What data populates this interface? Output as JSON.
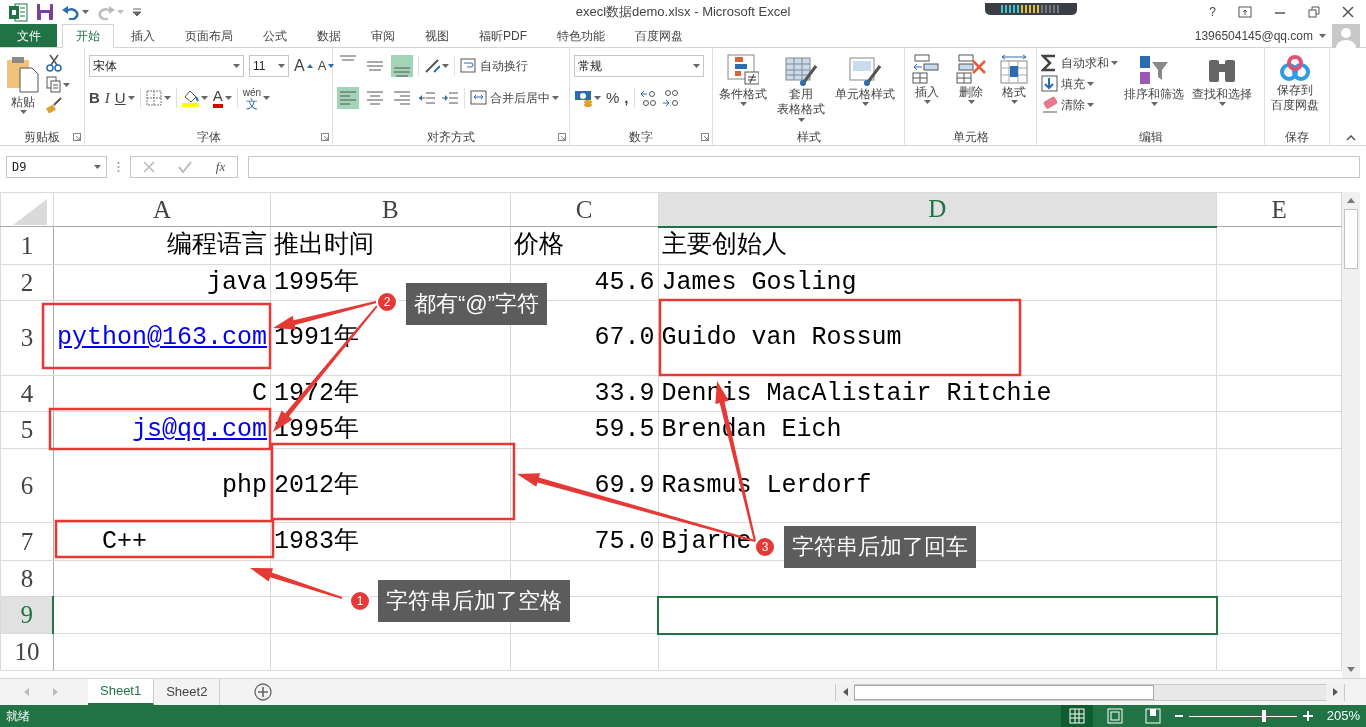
{
  "window": {
    "title": "execl数据demo.xlsx - Microsoft Excel",
    "help": "?"
  },
  "menu_tabs": [
    {
      "label": "文件",
      "kind": "file",
      "selected": false
    },
    {
      "label": "开始",
      "kind": "tab",
      "selected": true
    },
    {
      "label": "插入",
      "kind": "tab",
      "selected": false
    },
    {
      "label": "页面布局",
      "kind": "tab",
      "selected": false
    },
    {
      "label": "公式",
      "kind": "tab",
      "selected": false
    },
    {
      "label": "数据",
      "kind": "tab",
      "selected": false
    },
    {
      "label": "审阅",
      "kind": "tab",
      "selected": false
    },
    {
      "label": "视图",
      "kind": "tab",
      "selected": false
    },
    {
      "label": "福昕PDF",
      "kind": "tab",
      "selected": false
    },
    {
      "label": "特色功能",
      "kind": "tab",
      "selected": false
    },
    {
      "label": "百度网盘",
      "kind": "tab",
      "selected": false
    }
  ],
  "account": {
    "email": "1396504145@qq.com"
  },
  "ribbon": {
    "groups": [
      {
        "title": "剪贴板",
        "buttons": [
          {
            "label": "粘贴"
          }
        ]
      },
      {
        "title": "字体",
        "font": "宋体",
        "size": "11",
        "buttons": [
          {
            "label": "A"
          },
          {
            "label": "A"
          },
          {
            "label": "B"
          },
          {
            "label": "I"
          },
          {
            "label": "U"
          },
          {
            "label": "A"
          },
          {
            "lines": [
              "wén",
              "文"
            ]
          }
        ]
      },
      {
        "title": "对齐方式",
        "aligns": [
          {
            "selected": false
          },
          {
            "selected": false
          },
          {
            "selected": true
          },
          {
            "selected": true
          },
          {
            "selected": false
          },
          {
            "selected": false
          }
        ],
        "buttons": [
          {
            "label": "自动换行"
          },
          {
            "label": "合并后居中"
          }
        ]
      },
      {
        "title": "数字",
        "format": "常规",
        "buttons": [
          {
            "label": "%"
          },
          {
            "label": ","
          }
        ]
      },
      {
        "title": "样式",
        "buttons": [
          {
            "label": "条件格式"
          },
          {
            "lines": [
              "套用",
              "表格格式"
            ]
          },
          {
            "label": "单元格样式"
          }
        ]
      },
      {
        "title": "单元格",
        "buttons": [
          {
            "label": "插入"
          },
          {
            "label": "删除"
          },
          {
            "label": "格式"
          }
        ]
      },
      {
        "title": "编辑",
        "buttons": [
          {
            "label": "自动求和"
          },
          {
            "label": "填充"
          },
          {
            "label": "清除"
          },
          {
            "label": "排序和筛选"
          },
          {
            "label": "查找和选择"
          }
        ]
      },
      {
        "title": "保存",
        "buttons": [
          {
            "lines": [
              "保存到",
              "百度网盘"
            ]
          }
        ]
      }
    ]
  },
  "formula_bar": {
    "name_box": "D9",
    "fx": "fx"
  },
  "columns": [
    {
      "label": "A",
      "selected": false
    },
    {
      "label": "B",
      "selected": false
    },
    {
      "label": "C",
      "selected": false
    },
    {
      "label": "D",
      "selected": true
    },
    {
      "label": "E",
      "selected": false
    }
  ],
  "rows": [
    {
      "label": "1",
      "selected": false,
      "cells": [
        {
          "text": "编程语言",
          "right_aligned": true,
          "selected": false
        },
        {
          "text": "推出时间",
          "right_aligned": false,
          "selected": false
        },
        {
          "text": "价格",
          "right_aligned": false,
          "selected": false
        },
        {
          "text": "主要创始人",
          "right_aligned": false,
          "selected": false
        }
      ]
    },
    {
      "label": "2",
      "selected": false,
      "cells": [
        {
          "text": "java",
          "right_aligned": true,
          "selected": false
        },
        {
          "text": "1995年",
          "right_aligned": false,
          "selected": false
        },
        {
          "text": "45.6",
          "right_aligned": true,
          "selected": false
        },
        {
          "text": "James Gosling",
          "right_aligned": false,
          "selected": false
        }
      ]
    },
    {
      "label": "3",
      "selected": false,
      "cells": [
        {
          "text": "python@163.com",
          "kind": "link",
          "right_aligned": true,
          "selected": false
        },
        {
          "text": "1991年",
          "right_aligned": false,
          "selected": false
        },
        {
          "text": "67.0",
          "right_aligned": true,
          "selected": false
        },
        {
          "text": "Guido van Rossum\n",
          "right_aligned": false,
          "selected": false
        }
      ]
    },
    {
      "label": "4",
      "selected": false,
      "cells": [
        {
          "text": "C",
          "right_aligned": true,
          "selected": false
        },
        {
          "text": "1972年",
          "right_aligned": false,
          "selected": false
        },
        {
          "text": "33.9",
          "right_aligned": true,
          "selected": false
        },
        {
          "text": "Dennis MacAlistair Ritchie",
          "right_aligned": false,
          "selected": false
        }
      ]
    },
    {
      "label": "5",
      "selected": false,
      "cells": [
        {
          "text": "js@qq.com",
          "kind": "link",
          "right_aligned": true,
          "selected": false
        },
        {
          "text": "1995年",
          "right_aligned": false,
          "selected": false
        },
        {
          "text": "59.5",
          "right_aligned": true,
          "selected": false
        },
        {
          "text": "Brendan Eich",
          "right_aligned": false,
          "selected": false
        }
      ]
    },
    {
      "label": "6",
      "selected": false,
      "cells": [
        {
          "text": "php",
          "right_aligned": true,
          "selected": false
        },
        {
          "text": "2012年\n",
          "right_aligned": false,
          "selected": false
        },
        {
          "text": "69.9",
          "right_aligned": true,
          "selected": false
        },
        {
          "text": "Rasmus Lerdorf",
          "right_aligned": false,
          "selected": false
        }
      ]
    },
    {
      "label": "7",
      "selected": false,
      "cells": [
        {
          "text": "C++        ",
          "right_aligned": true,
          "selected": false
        },
        {
          "text": "1983年",
          "right_aligned": false,
          "selected": false
        },
        {
          "text": "75.0",
          "right_aligned": true,
          "selected": false
        },
        {
          "text": "Bjarne",
          "right_aligned": false,
          "selected": false
        }
      ]
    },
    {
      "label": "8",
      "selected": false
    },
    {
      "label": "9",
      "selected": true,
      "cells": [
        {
          "selected": false
        },
        {
          "selected": false
        },
        {
          "selected": false
        },
        {
          "selected": true
        }
      ]
    },
    {
      "label": "10",
      "selected": false
    }
  ],
  "callouts": [
    {
      "number": "2",
      "text": "都有“@”字符"
    },
    {
      "number": "3",
      "text": "字符串后加了回车"
    },
    {
      "number": "1",
      "text": "字符串后加了空格"
    }
  ],
  "sheets": [
    {
      "label": "Sheet1",
      "selected": true
    },
    {
      "label": "Sheet2",
      "selected": false
    }
  ],
  "status_bar": {
    "text": "就绪",
    "views": [
      {
        "selected": true
      },
      {
        "selected": false
      },
      {
        "selected": false
      }
    ],
    "zoom": {
      "level": 0.7,
      "label": "205%"
    }
  }
}
